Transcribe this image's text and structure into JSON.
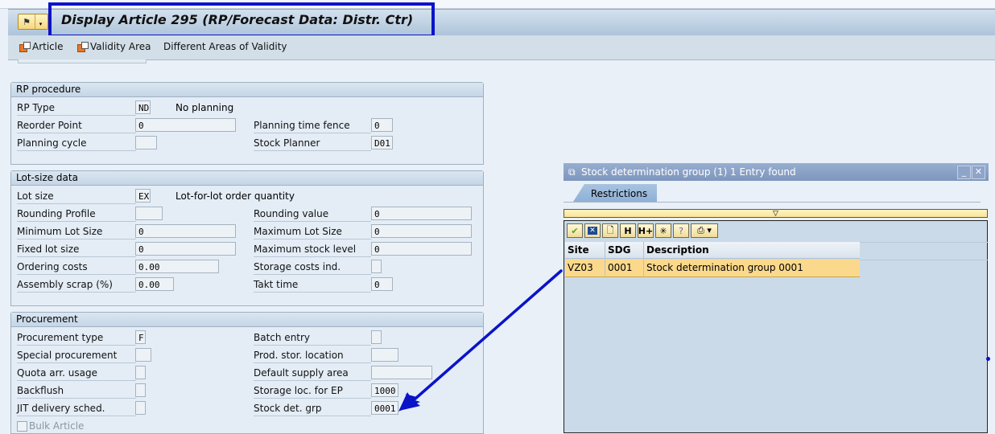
{
  "window": {
    "title": "Display Article 295 (RP/Forecast Data: Distr. Ctr)",
    "command_button_icon": "command-field-icon"
  },
  "app_toolbar": {
    "items": [
      {
        "label": "Article",
        "icon": "article-icon"
      },
      {
        "label": "Validity Area",
        "icon": "validity-area-icon"
      },
      {
        "label": "Different Areas of Validity"
      }
    ]
  },
  "rp_procedure": {
    "title": "RP procedure",
    "rp_type": {
      "label": "RP Type",
      "value": "ND",
      "description": "No planning"
    },
    "reorder_point": {
      "label": "Reorder Point",
      "value": "0"
    },
    "planning_time_fence": {
      "label": "Planning time fence",
      "value": "0"
    },
    "planning_cycle": {
      "label": "Planning cycle",
      "value": ""
    },
    "stock_planner": {
      "label": "Stock Planner",
      "value": "D01"
    }
  },
  "lot_size_data": {
    "title": "Lot-size data",
    "lot_size": {
      "label": "Lot size",
      "value": "EX",
      "description": "Lot-for-lot order quantity"
    },
    "rounding_profile": {
      "label": "Rounding Profile",
      "value": ""
    },
    "rounding_value": {
      "label": "Rounding value",
      "value": "0"
    },
    "min_lot_size": {
      "label": "Minimum Lot Size",
      "value": "0"
    },
    "max_lot_size": {
      "label": "Maximum Lot Size",
      "value": "0"
    },
    "fixed_lot_size": {
      "label": "Fixed lot size",
      "value": "0"
    },
    "max_stock_level": {
      "label": "Maximum stock level",
      "value": "0"
    },
    "ordering_costs": {
      "label": "Ordering costs",
      "value": "0.00"
    },
    "storage_costs_ind": {
      "label": "Storage costs ind.",
      "value": ""
    },
    "assembly_scrap": {
      "label": "Assembly scrap (%)",
      "value": "0.00"
    },
    "takt_time": {
      "label": "Takt time",
      "value": "0"
    }
  },
  "procurement": {
    "title": "Procurement",
    "procurement_type": {
      "label": "Procurement type",
      "value": "F"
    },
    "batch_entry": {
      "label": "Batch entry",
      "value": ""
    },
    "special_procurement": {
      "label": "Special procurement",
      "value": ""
    },
    "prod_stor_location": {
      "label": "Prod. stor. location",
      "value": ""
    },
    "quota_arr_usage": {
      "label": "Quota arr. usage",
      "value": ""
    },
    "default_supply_area": {
      "label": "Default supply area",
      "value": ""
    },
    "backflush": {
      "label": "Backflush",
      "value": ""
    },
    "storage_loc_ep": {
      "label": "Storage loc. for EP",
      "value": "1000"
    },
    "jit_delivery": {
      "label": "JIT delivery sched.",
      "value": ""
    },
    "stock_det_grp": {
      "label": "Stock det. grp",
      "value": "0001"
    },
    "bulk_article": {
      "label": "Bulk Article",
      "checked": false
    }
  },
  "popup": {
    "title": "Stock determination group (1)",
    "entries_found": "1 Entry found",
    "tab": "Restrictions",
    "collapse_icon": "▽",
    "toolbar": [
      "check-icon",
      "cancel-icon",
      "new-document-icon",
      "find-icon",
      "find-next-icon",
      "select-icon",
      "help-icon",
      "print-icon"
    ],
    "columns": [
      "Site",
      "SDG",
      "Description"
    ],
    "rows": [
      {
        "site": "VZ03",
        "sdg": "0001",
        "description": "Stock determination group 0001"
      }
    ]
  },
  "annotation": {
    "color": "#0b13c9"
  }
}
